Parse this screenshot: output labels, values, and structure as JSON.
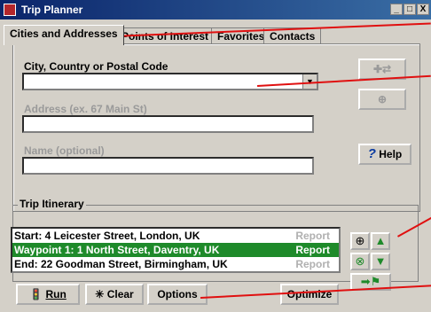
{
  "window": {
    "title": "Trip Planner",
    "controls": [
      "_",
      "□",
      "X"
    ]
  },
  "tabs": [
    "Cities and Addresses",
    "Points of Interest",
    "Favorites",
    "Contacts"
  ],
  "fields": {
    "city_label": "City, Country or Postal Code",
    "city_value": "",
    "address_label": "Address (ex. 67 Main St)",
    "address_value": "",
    "name_label": "Name (optional)",
    "name_value": ""
  },
  "buttons": {
    "help": "Help",
    "run": "Run",
    "clear": "Clear",
    "options": "Options",
    "optimize": "Optimize"
  },
  "itinerary": {
    "label": "Trip Itinerary",
    "rows": [
      {
        "text": "Start: 4 Leicester Street, London, UK",
        "report": "Report",
        "selected": false
      },
      {
        "text": "Waypoint 1: 1 North Street, Daventry, UK",
        "report": "Report",
        "selected": true
      },
      {
        "text": "End: 22 Goodman Street, Birmingham, UK",
        "report": "Report",
        "selected": false
      }
    ]
  },
  "colors": {
    "selection": "#1e8a2a",
    "callout": "#e01010",
    "titlebar": "#0a246a"
  },
  "icons": [
    "app-icon",
    "add-to-trip-icon",
    "zoom-icon",
    "help-question-icon",
    "traffic-light-icon",
    "broom-icon",
    "move-up-icon",
    "move-down-icon",
    "delete-waypoint-icon",
    "reverse-route-icon"
  ]
}
